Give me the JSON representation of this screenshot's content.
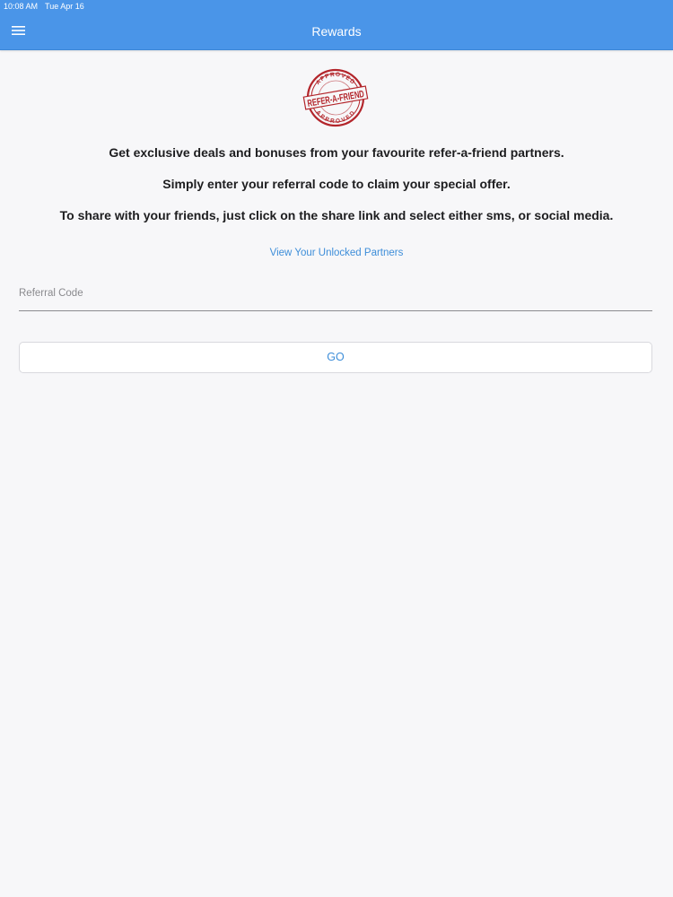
{
  "status_bar": {
    "time": "10:08 AM",
    "date": "Tue Apr 16"
  },
  "header": {
    "title": "Rewards",
    "menu_icon": "hamburger-menu-icon",
    "background_color": "#4a95e8"
  },
  "badge": {
    "icon": "refer-a-friend-approved-stamp",
    "main_text": "REFER-A-FRIEND",
    "ring_text": "APPROVED",
    "color": "#b3252b"
  },
  "intro": {
    "line1": "Get exclusive deals and bonuses from your favourite refer-a-friend partners.",
    "line2": "Simply enter your referral code to claim your special offer.",
    "line3": "To share with your friends, just click on the share link and select either sms, or social media."
  },
  "links": {
    "unlocked_partners": "View Your Unlocked Partners"
  },
  "referral": {
    "placeholder": "Referral Code",
    "value": ""
  },
  "actions": {
    "go_label": "GO"
  },
  "colors": {
    "accent": "#3e8ed9",
    "page_background": "#f7f7f9"
  }
}
